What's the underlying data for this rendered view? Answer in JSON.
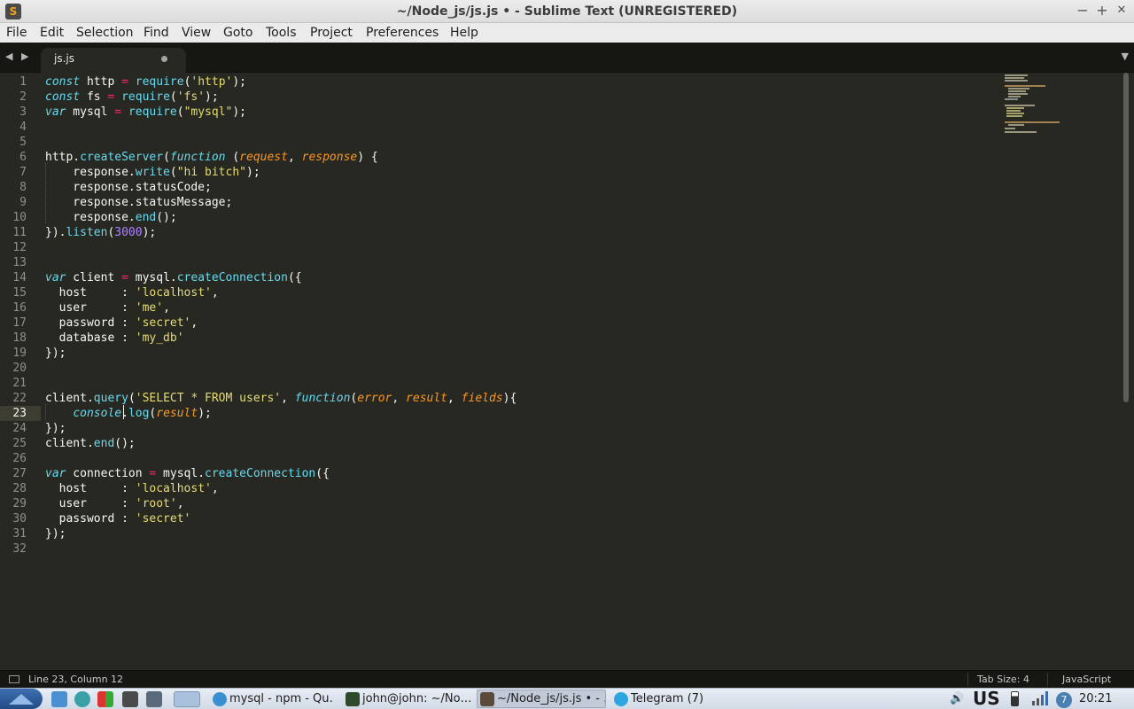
{
  "window": {
    "title": "~/Node_js/js.js • - Sublime Text (UNREGISTERED)",
    "app_icon": "S",
    "minimize": "−",
    "maximize": "+",
    "close": "✕"
  },
  "menu": [
    "File",
    "Edit",
    "Selection",
    "Find",
    "View",
    "Goto",
    "Tools",
    "Project",
    "Preferences",
    "Help"
  ],
  "tabs": {
    "nav_arrows": "◀ ▶",
    "active": {
      "label": "js.js",
      "modified": true
    },
    "dropdown_icon": "▼"
  },
  "editor": {
    "current_line": 23,
    "line_numbers": [
      "1",
      "2",
      "3",
      "4",
      "5",
      "6",
      "7",
      "8",
      "9",
      "10",
      "11",
      "12",
      "13",
      "14",
      "15",
      "16",
      "17",
      "18",
      "19",
      "20",
      "21",
      "22",
      "23",
      "24",
      "25",
      "26",
      "27",
      "28",
      "29",
      "30",
      "31",
      "32"
    ],
    "lines": [
      "const http = require('http');",
      "const fs = require('fs');",
      "var mysql = require(\"mysql\");",
      "",
      "",
      "http.createServer(function (request, response) {",
      "    response.write(\"hi bitch\");",
      "    response.statusCode;",
      "    response.statusMessage;",
      "    response.end();",
      "}).listen(3000);",
      "",
      "",
      "var client = mysql.createConnection({",
      "  host     : 'localhost',",
      "  user     : 'me',",
      "  password : 'secret',",
      "  database : 'my_db'",
      "});",
      "",
      "",
      "client.query('SELECT * FROM users', function(error, result, fields){",
      "    console.log(result);",
      "});",
      "client.end();",
      "",
      "var connection = mysql.createConnection({",
      "  host     : 'localhost',",
      "  user     : 'root',",
      "  password : 'secret'",
      "});",
      ""
    ]
  },
  "status_bar": {
    "position": "Line 23, Column 12",
    "tab_size": "Tab Size: 4",
    "syntax": "JavaScript"
  },
  "taskbar": {
    "start_icon": "start-menu-icon",
    "tasks": [
      {
        "label": "mysql - npm - Qu…",
        "icon_color": "#3a8fd0",
        "active": false
      },
      {
        "label": "john@john: ~/No…",
        "icon_color": "#2d4a2d",
        "active": false
      },
      {
        "label": "~/Node_js/js.js • - …",
        "icon_color": "#5a4a3a",
        "active": true
      },
      {
        "label": "Telegram (7)",
        "icon_color": "#2ca5e0",
        "active": false
      }
    ],
    "tray": {
      "volume_icon": "🔊",
      "keyboard_layout": "US",
      "notification_count": "7",
      "clock": "20:21"
    }
  },
  "colors": {
    "background": "#272822",
    "keyword": "#66d9ef",
    "operator": "#f92672",
    "string": "#e6db74",
    "number": "#ae81ff",
    "parameter": "#fd971f"
  }
}
